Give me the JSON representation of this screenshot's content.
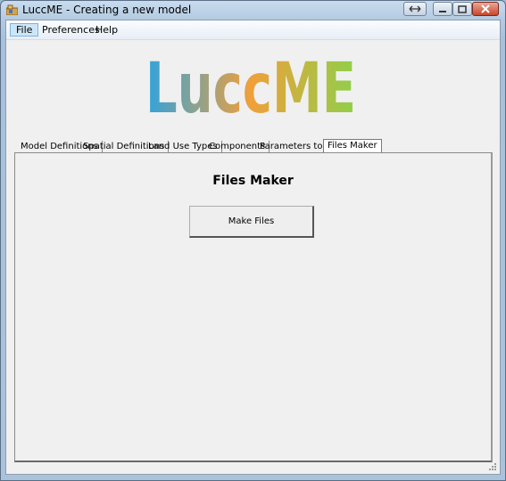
{
  "window": {
    "title": "LuccME - Creating a new model",
    "controls": [
      "restore-icon",
      "minimize-icon",
      "maximize-icon",
      "close-icon"
    ]
  },
  "menu": {
    "items": [
      {
        "label": "File",
        "active": true
      },
      {
        "label": "Preferences"
      },
      {
        "label": "Help"
      }
    ]
  },
  "logo": {
    "text": "LuccME",
    "colors": [
      "#2fa3de",
      "#f0a03a",
      "#8fcf4a"
    ]
  },
  "tabs": [
    {
      "label": "Model Definitions"
    },
    {
      "label": "Spatial Definitions"
    },
    {
      "label": "Land Use Types"
    },
    {
      "label": "Components"
    },
    {
      "label": "Parameters to Save"
    },
    {
      "label": "Files Maker",
      "selected": true
    }
  ],
  "panel": {
    "title": "Files Maker",
    "make_button_label": "Make Files"
  }
}
